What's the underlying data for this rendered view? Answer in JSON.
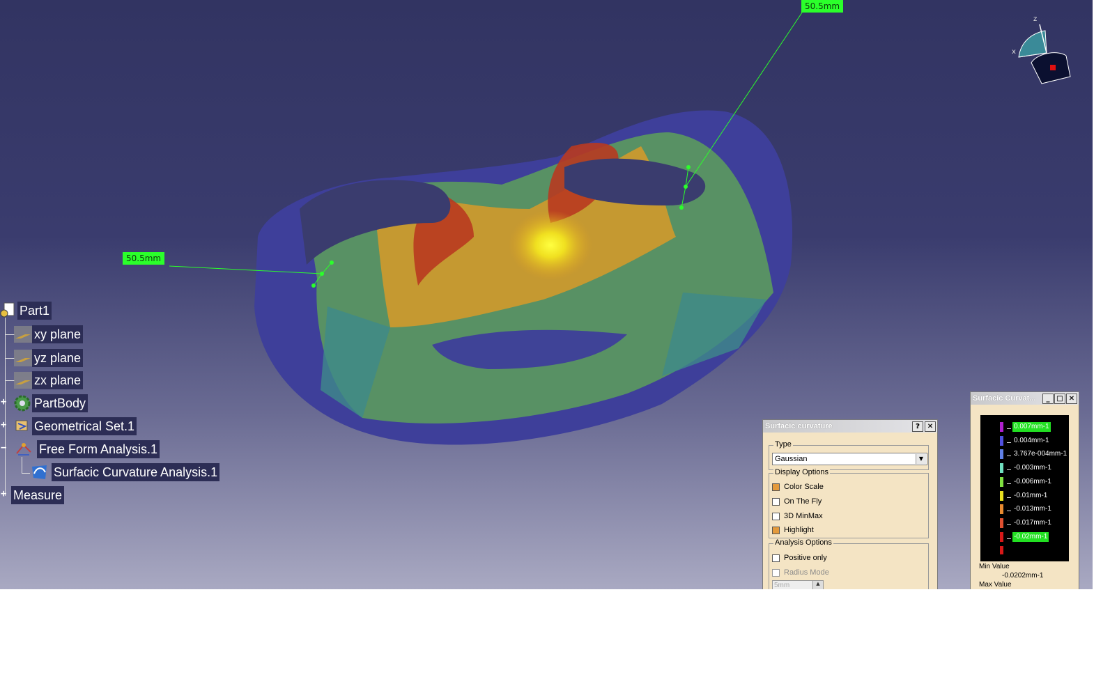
{
  "viewport": {
    "dimension_left": "50.5mm",
    "dimension_right": "50.5mm",
    "compass_axes": {
      "x": "x",
      "z": "z"
    }
  },
  "tree": {
    "root": "Part1",
    "items": [
      {
        "label": "xy plane",
        "icon": "plane-icon"
      },
      {
        "label": "yz plane",
        "icon": "plane-icon"
      },
      {
        "label": "zx plane",
        "icon": "plane-icon"
      },
      {
        "label": "PartBody",
        "icon": "gear-body-icon"
      },
      {
        "label": "Geometrical Set.1",
        "icon": "geometrical-set-icon"
      },
      {
        "label": "Free Form Analysis.1",
        "icon": "analysis-icon"
      },
      {
        "label": "Surfacic Curvature Analysis.1",
        "icon": "curvature-analysis-icon"
      },
      {
        "label": "Measure",
        "icon": ""
      }
    ]
  },
  "dialog": {
    "title": "Surfacic curvature",
    "help_btn": "?",
    "close_btn": "✕",
    "type_group": "Type",
    "type_value": "Gaussian",
    "display_group": "Display Options",
    "options": [
      {
        "label": "Color Scale",
        "checked": true
      },
      {
        "label": "On The Fly",
        "checked": false
      },
      {
        "label": "3D MinMax",
        "checked": false
      },
      {
        "label": "Highlight",
        "checked": true
      }
    ],
    "analysis_group": "Analysis Options",
    "analysis_options": [
      {
        "label": "Positive only",
        "checked": false
      },
      {
        "label": "Radius Mode",
        "checked": false,
        "disabled": true
      }
    ],
    "radius_value": "5mm"
  },
  "scale_window": {
    "title": "Surfacic Curvat...",
    "entries": [
      {
        "label": "0.007mm-1",
        "color": "#b020d0",
        "highlight": true
      },
      {
        "label": "0.004mm-1",
        "color": "#5050e0",
        "highlight": false
      },
      {
        "label": "3.767e-004mm-1",
        "color": "#6080e8",
        "highlight": false
      },
      {
        "label": "-0.003mm-1",
        "color": "#70e0c0",
        "highlight": false
      },
      {
        "label": "-0.006mm-1",
        "color": "#80e040",
        "highlight": false
      },
      {
        "label": "-0.01mm-1",
        "color": "#e8e020",
        "highlight": false
      },
      {
        "label": "-0.013mm-1",
        "color": "#e88a30",
        "highlight": false
      },
      {
        "label": "-0.017mm-1",
        "color": "#e05030",
        "highlight": false
      },
      {
        "label": "-0.02mm-1",
        "color": "#d81818",
        "highlight": true
      }
    ],
    "min_label": "Min Value",
    "min_value": "-0.0202mm-1",
    "max_label": "Max Value"
  }
}
